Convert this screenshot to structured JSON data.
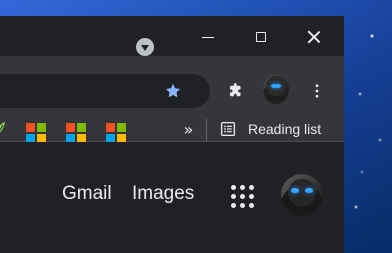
{
  "bookmarks_bar": {
    "overflow_label": "»",
    "reading_list_label": "Reading list"
  },
  "page": {
    "gmail_label": "Gmail",
    "images_label": "Images"
  },
  "colors": {
    "browser_dark": "#202124",
    "toolbar_gray": "#35363a",
    "star_blue": "#8ab4f8",
    "desktop_blue": "#0f3f9e"
  },
  "icons": {
    "tab_search": "chevron-down-circle",
    "minimize": "minimize",
    "maximize": "maximize",
    "close": "close",
    "bookmark_star": "star",
    "extensions": "puzzle-piece",
    "profile": "avatar",
    "menu": "vertical-ellipsis",
    "reading_list": "list",
    "apps": "grid-dots"
  }
}
